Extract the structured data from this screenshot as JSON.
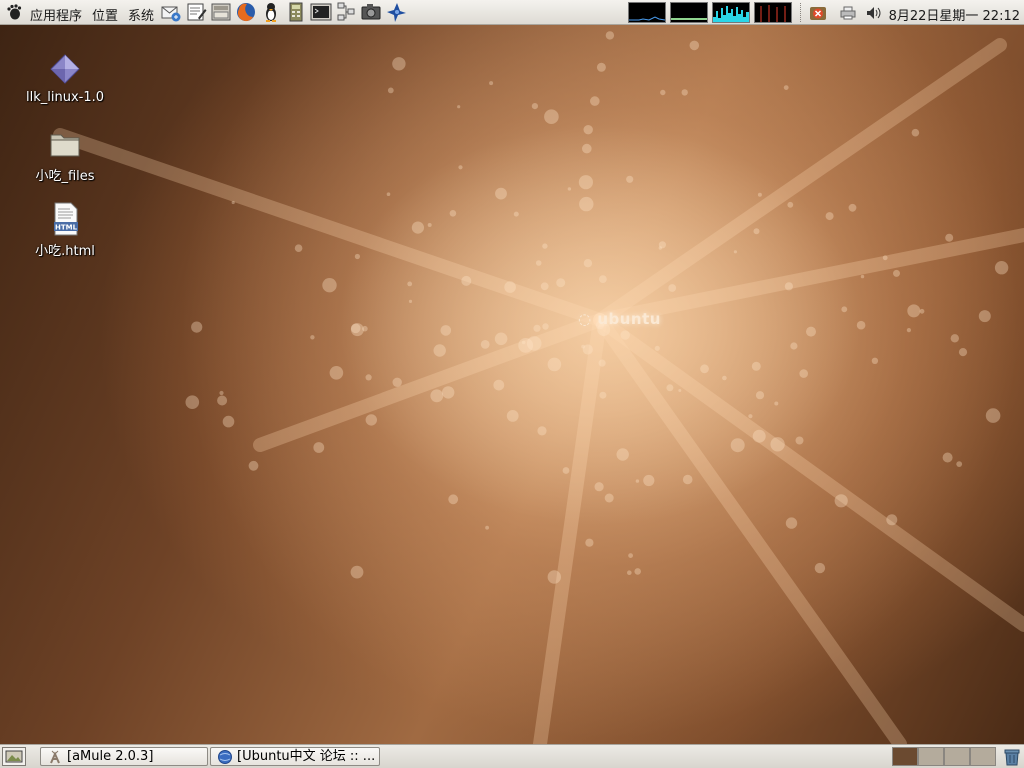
{
  "top_panel": {
    "menus": [
      "应用程序",
      "位置",
      "系统"
    ],
    "launchers": [
      "evolution-mail-icon",
      "text-editor-icon",
      "file-manager-icon",
      "firefox-icon",
      "qq-penguin-icon",
      "calculator-icon",
      "terminal-icon",
      "network-icon",
      "screenshot-camera-icon",
      "blue-app-icon"
    ],
    "clock": "8月22日星期一 22:12",
    "tray_icons": [
      "update-notifier-icon",
      "printer-icon",
      "volume-icon"
    ]
  },
  "desktop": {
    "icons": [
      {
        "label": "llk_linux-1.0",
        "icon": "diamond-package-icon"
      },
      {
        "label": "小吃_files",
        "icon": "folder-icon"
      },
      {
        "label": "小吃.html",
        "icon": "html-document-icon"
      }
    ],
    "wallpaper_logo": "ubuntu"
  },
  "bottom_panel": {
    "tasks": [
      {
        "label": "[aMule 2.0.3]",
        "icon": "amule-icon"
      },
      {
        "label": "[Ubuntu中文 论坛 :: ...",
        "icon": "firefox-globe-icon"
      }
    ],
    "workspaces": 4,
    "active_workspace": 1
  },
  "colors": {
    "panel_bg": "#e8e5df",
    "wallpaper_base": "#6e4226",
    "wallpaper_glow": "#e0a46c",
    "active_workspace": "#6b4a30"
  }
}
